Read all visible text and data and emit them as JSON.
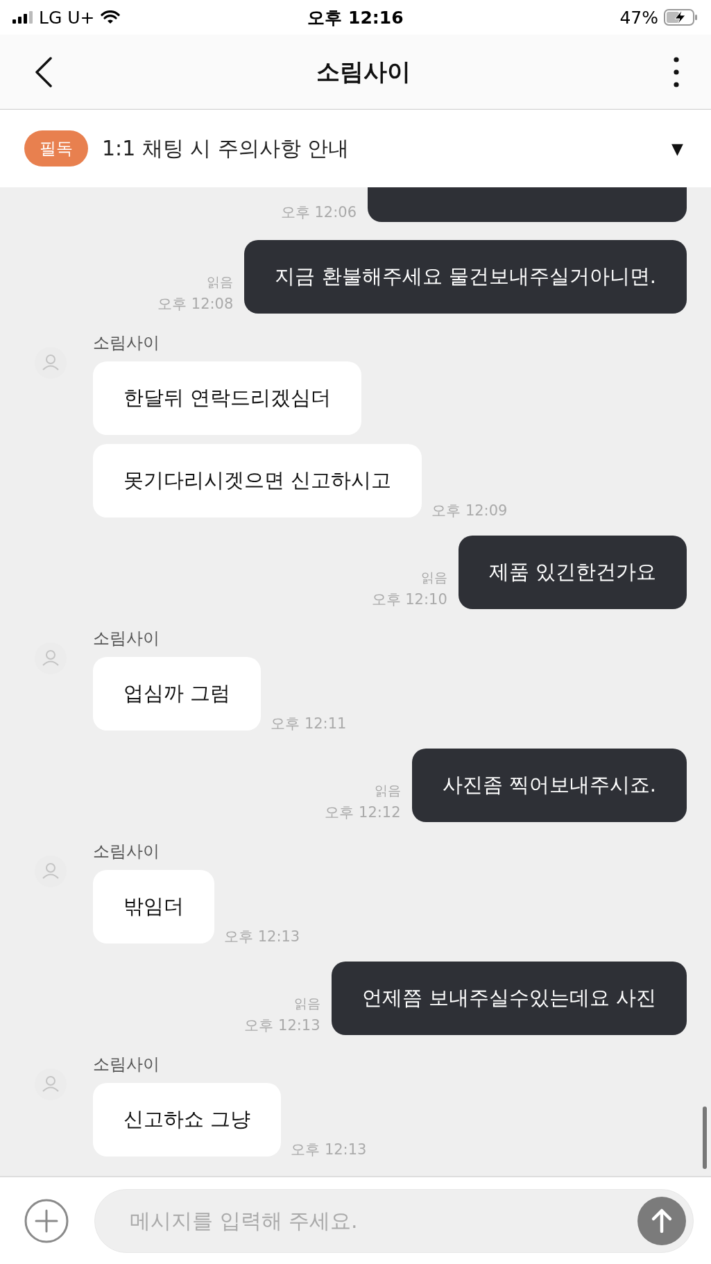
{
  "status_bar": {
    "carrier": "LG U+",
    "time": "오후 12:16",
    "battery": "47%"
  },
  "header": {
    "title": "소림사이"
  },
  "notice": {
    "badge": "필독",
    "text": "1:1 채팅 시 주의사항 안내",
    "toggle": "▼"
  },
  "messages": [
    {
      "kind": "sent_cut",
      "time": "오후 12:06"
    },
    {
      "kind": "sent",
      "read": "읽음",
      "time": "오후 12:08",
      "text": "지금 환불해주세요 물건보내주실거아니면."
    },
    {
      "kind": "received",
      "sender": "소림사이",
      "bubbles": [
        "한달뒤 연락드리겠심더",
        "못기다리시겟으면 신고하시고"
      ],
      "time": "오후 12:09"
    },
    {
      "kind": "sent",
      "read": "읽음",
      "time": "오후 12:10",
      "text": "제품 있긴한건가요"
    },
    {
      "kind": "received",
      "sender": "소림사이",
      "bubbles": [
        "업심까 그럼"
      ],
      "time": "오후 12:11"
    },
    {
      "kind": "sent",
      "read": "읽음",
      "time": "오후 12:12",
      "text": "사진좀 찍어보내주시죠."
    },
    {
      "kind": "received",
      "sender": "소림사이",
      "bubbles": [
        "밖임더"
      ],
      "time": "오후 12:13"
    },
    {
      "kind": "sent",
      "read": "읽음",
      "time": "오후 12:13",
      "text": "언제쯤 보내주실수있는데요 사진"
    },
    {
      "kind": "received",
      "sender": "소림사이",
      "bubbles": [
        "신고하쇼 그냥"
      ],
      "time": "오후 12:13"
    }
  ],
  "composer": {
    "placeholder": "메시지를 입력해 주세요."
  }
}
